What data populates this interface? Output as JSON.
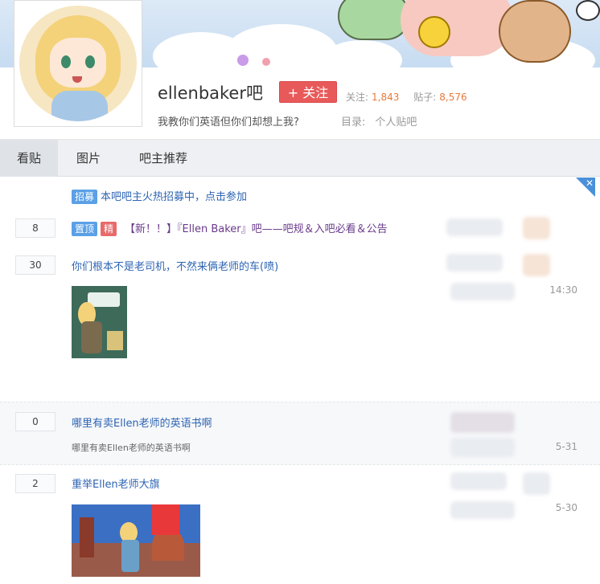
{
  "forum": {
    "name": "ellenbaker吧",
    "follow_label": "+ 关注",
    "follow_count_label": "关注:",
    "follow_count": "1,843",
    "post_count_label": "贴子:",
    "post_count": "8,576",
    "slogan": "我教你们英语但你们却想上我?",
    "catalog_label": "目录:",
    "catalog_value": "个人贴吧"
  },
  "tabs": [
    {
      "label": "看贴",
      "active": true
    },
    {
      "label": "图片",
      "active": false
    },
    {
      "label": "吧主推荐",
      "active": false
    }
  ],
  "close_label": "✕",
  "posts": [
    {
      "badges": [
        "招募"
      ],
      "title": "本吧吧主火热招募中，点击参加",
      "replies": null
    },
    {
      "badges": [
        "置顶",
        "精"
      ],
      "title": "【新！！】『Ellen Baker』吧——吧规＆入吧必看＆公告",
      "replies": "8"
    },
    {
      "badges": [],
      "title": "你们根本不是老司机，不然来俩老师的车(喷)",
      "replies": "30",
      "time": "14:30"
    },
    {
      "badges": [],
      "title": "哪里有卖Ellen老师的英语书啊",
      "subtitle": "哪里有卖Ellen老师的英语书啊",
      "replies": "0",
      "time": "5-31"
    },
    {
      "badges": [],
      "title": "重举Ellen老师大旗",
      "replies": "2",
      "time": "5-30"
    }
  ],
  "colors": {
    "link": "#2d64b3",
    "accent_red": "#e85a5a",
    "badge_blue": "#5aa0e6",
    "badge_red": "#e86a6a",
    "number_orange": "#e87a3a"
  }
}
